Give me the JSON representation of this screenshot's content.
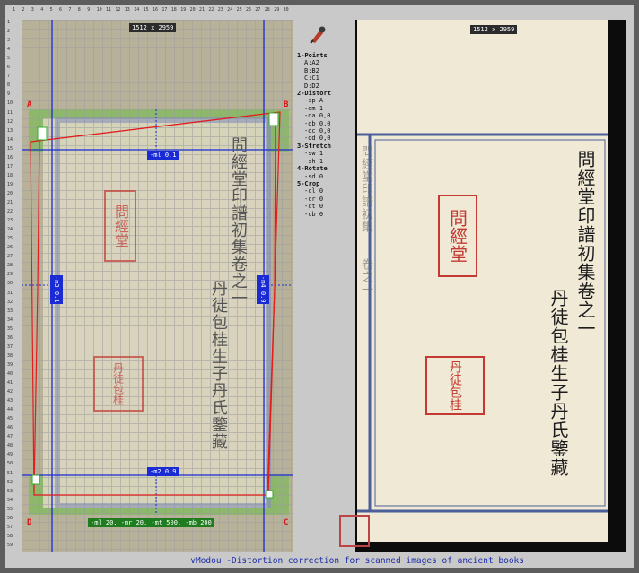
{
  "app": {
    "caption": "vModou -Distortion correction for scanned images of ancient books"
  },
  "left": {
    "dimensions": "1512 x 2959",
    "corners": {
      "a": "A",
      "b": "B",
      "c": "C",
      "d": "D"
    },
    "labels": {
      "ml": "-ml 0.1",
      "m2": "-m2 0.9",
      "left_vert": "-m3 0.1",
      "right_vert": "-m4 0.9",
      "bottom": "-ml 20, -mr 20, -mt 500, -mb 200"
    }
  },
  "ruler": {
    "top": [
      "1",
      "2",
      "3",
      "4",
      "5",
      "6",
      "7",
      "8",
      "9",
      "10",
      "11",
      "12",
      "13",
      "14",
      "15",
      "16",
      "17",
      "18",
      "19",
      "20",
      "21",
      "22",
      "23",
      "24",
      "25",
      "26",
      "27",
      "28",
      "29",
      "30"
    ],
    "left": [
      "1",
      "2",
      "3",
      "4",
      "5",
      "6",
      "7",
      "8",
      "9",
      "10",
      "11",
      "12",
      "13",
      "14",
      "15",
      "16",
      "17",
      "18",
      "19",
      "20",
      "21",
      "22",
      "23",
      "24",
      "25",
      "26",
      "27",
      "28",
      "29",
      "30",
      "31",
      "32",
      "33",
      "34",
      "35",
      "36",
      "37",
      "38",
      "39",
      "40",
      "41",
      "42",
      "43",
      "44",
      "45",
      "46",
      "47",
      "48",
      "49",
      "50",
      "51",
      "52",
      "53",
      "54",
      "55",
      "56",
      "57",
      "58",
      "59"
    ]
  },
  "side": [
    {
      "h": "1-Points",
      "items": [
        "A:A2",
        "B:B2",
        "C:C1",
        "D:D2"
      ]
    },
    {
      "h": "2-Distort",
      "items": [
        "-sp A",
        "-dm 1",
        "-da 0,0",
        "-db 0,0",
        "-dc 0,0",
        "-dd 0,0"
      ]
    },
    {
      "h": "3-Stretch",
      "items": [
        "-sw 1",
        "-sh 1"
      ]
    },
    {
      "h": "4-Rotate",
      "items": [
        "-sd 0"
      ]
    },
    {
      "h": "5-Crop",
      "items": [
        "-cl 0",
        "-cr 0",
        "-ct 0",
        "-cb 0"
      ]
    }
  ],
  "right": {
    "dimensions": "1512 x 2959",
    "title_text": "問經堂印譜初集卷之一",
    "owner_text": "丹徒包桂生子丹氏鑒藏",
    "seal1": "問經堂",
    "seal2": "丹徒包桂",
    "prev_page": "問經堂印譜初集",
    "prev_page2": "卷之一"
  }
}
